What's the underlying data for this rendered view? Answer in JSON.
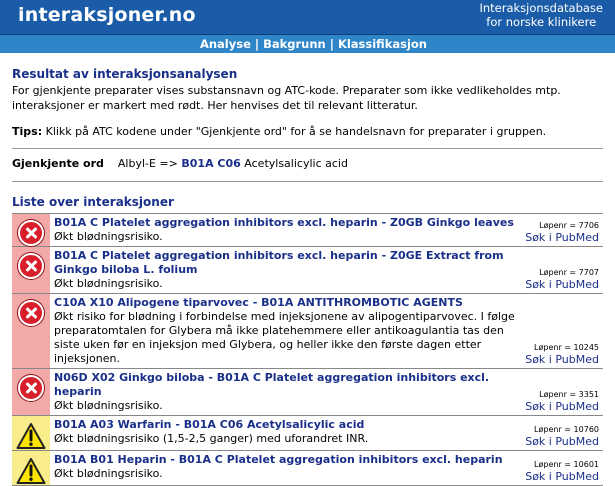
{
  "header": {
    "logo": "interaksjoner.no",
    "tagline_line1": "Interaksjonsdatabase",
    "tagline_line2": "for norske klinikere"
  },
  "nav": {
    "items": [
      "Analyse",
      "Bakgrunn",
      "Klassifikasjon"
    ],
    "separator": "|"
  },
  "intro": {
    "title": "Resultat av interaksjonsanalysen",
    "text": "For gjenkjente preparater vises substansnavn og ATC-kode. Preparater som ikke vedlikeholdes mtp. interaksjoner er markert med rødt. Her henvises det til relevant litteratur.",
    "tips_label": "Tips:",
    "tips_text": " Klikk på ATC kodene under \"Gjenkjente ord\" for å se handelsnavn for preparater i gruppen."
  },
  "recognized": {
    "label": "Gjenkjente ord",
    "word": "Albyl-E",
    "arrow": " => ",
    "atc": "B01A C06",
    "substance": " Acetylsalicylic acid"
  },
  "list": {
    "title": "Liste over interaksjoner",
    "pubmed_label": "Søk i PubMed",
    "rows": [
      {
        "severity": "red",
        "icon": "stop-x-icon",
        "title": "B01A C Platelet aggregation inhibitors excl. heparin - Z0GB Ginkgo leaves",
        "description": "Økt blødningsrisiko.",
        "lopenr": "Løpenr = 7706"
      },
      {
        "severity": "red",
        "icon": "stop-x-icon",
        "title": "B01A C Platelet aggregation inhibitors excl. heparin - Z0GE Extract from Ginkgo biloba L. folium",
        "description": "Økt blødningsrisiko.",
        "lopenr": "Løpenr = 7707"
      },
      {
        "severity": "red",
        "icon": "stop-x-icon",
        "title": "C10A X10 Alipogene tiparvovec - B01A ANTITHROMBOTIC AGENTS",
        "description": "Økt risiko for blødning i forbindelse med injeksjonene av alipogentiparvovec. I følge preparatomtalen for Glybera må ikke platehemmere eller antikoagulantia tas den siste uken før en injeksjon med Glybera, og heller ikke den første dagen etter injeksjonen.",
        "lopenr": "Løpenr = 10245"
      },
      {
        "severity": "red",
        "icon": "stop-x-icon",
        "title": "N06D X02 Ginkgo biloba - B01A C Platelet aggregation inhibitors excl. heparin",
        "description": "Økt blødningsrisiko.",
        "lopenr": "Løpenr = 3351"
      },
      {
        "severity": "yellow",
        "icon": "warning-icon",
        "title": "B01A A03 Warfarin - B01A C06 Acetylsalicylic acid",
        "description": "Økt blødningsrisiko (1,5-2,5 ganger) med uforandret INR.",
        "lopenr": "Løpenr = 10760"
      },
      {
        "severity": "yellow",
        "icon": "warning-icon",
        "title": "B01A B01 Heparin - B01A C Platelet aggregation inhibitors excl. heparin",
        "description": "Økt blødningsrisiko.",
        "lopenr": "Løpenr = 10601"
      }
    ]
  },
  "colors": {
    "header_bg": "#1b5ca8",
    "nav_bg": "#2e86c8",
    "link": "#1a2f8a",
    "severity_red": "#f4a9a9",
    "severity_yellow": "#f8ed8a"
  }
}
